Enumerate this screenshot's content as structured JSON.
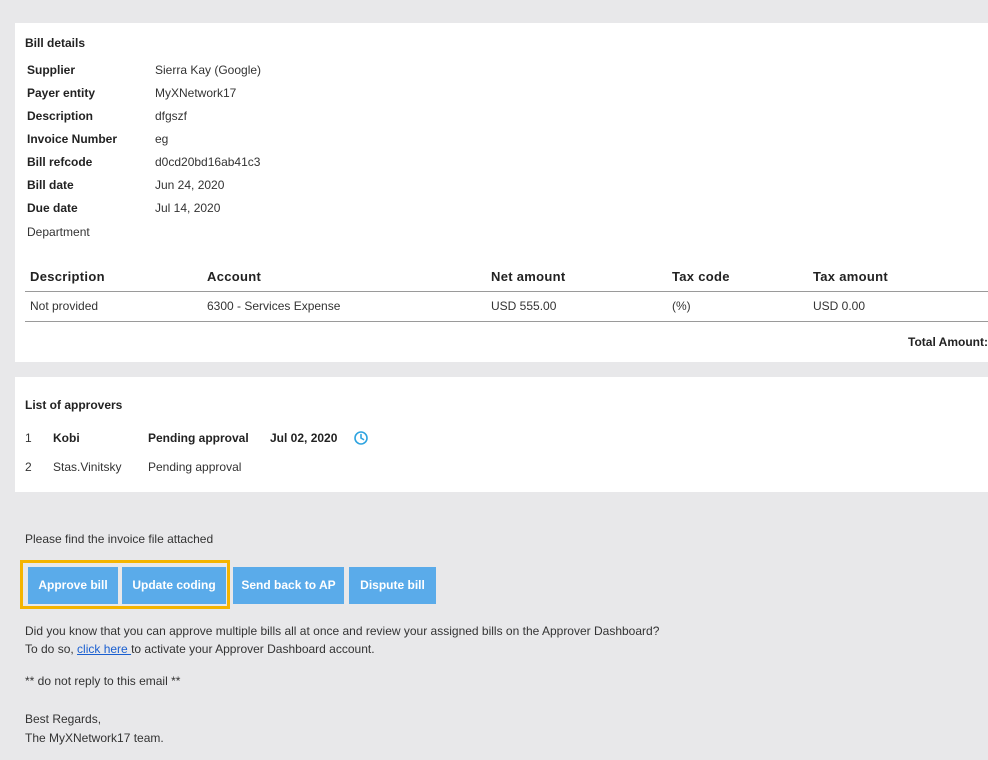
{
  "bill_details": {
    "title": "Bill details",
    "fields": [
      {
        "label": "Supplier",
        "value": "Sierra Kay (Google)"
      },
      {
        "label": "Payer entity",
        "value": "MyXNetwork17"
      },
      {
        "label": "Description",
        "value": "dfgszf"
      },
      {
        "label": "Invoice Number",
        "value": "eg"
      },
      {
        "label": "Bill refcode",
        "value": "d0cd20bd16ab41c3"
      },
      {
        "label": "Bill date",
        "value": "Jun 24, 2020"
      },
      {
        "label": "Due date",
        "value": "Jul 14, 2020"
      },
      {
        "label": "Department",
        "value": ""
      }
    ],
    "table": {
      "headers": [
        "Description",
        "Account",
        "Net amount",
        "Tax code",
        "Tax amount"
      ],
      "rows": [
        [
          "Not provided",
          "6300 - Services Expense",
          "USD 555.00",
          "(%)",
          "USD 0.00"
        ]
      ],
      "total_label": "Total Amount:"
    }
  },
  "approvers": {
    "title": "List of approvers",
    "items": [
      {
        "num": "1",
        "name": "Kobi",
        "status": "Pending approval",
        "date": "Jul 02, 2020",
        "icon": "clock-icon"
      },
      {
        "num": "2",
        "name": "Stas.Vinitsky",
        "status": "Pending approval",
        "date": ""
      }
    ]
  },
  "email": {
    "attachment_note": "Please find the invoice file attached",
    "buttons": {
      "approve": "Approve bill",
      "update": "Update coding",
      "send_back": "Send back to AP",
      "dispute": "Dispute bill"
    },
    "dashboard_line1": "Did you know that you can approve multiple bills all at once and review your assigned bills on the Approver Dashboard?",
    "dashboard_line2_prefix": "To do so, ",
    "dashboard_link": "click here ",
    "dashboard_line2_suffix": "to activate your Approver Dashboard account.",
    "no_reply": "** do not reply to this email **",
    "regards": "Best Regards,",
    "signature": "The MyXNetwork17 team."
  },
  "colors": {
    "background": "#e8e8ea",
    "button": "#5aabea",
    "highlight": "#f4b400",
    "link": "#1a5fd0"
  }
}
